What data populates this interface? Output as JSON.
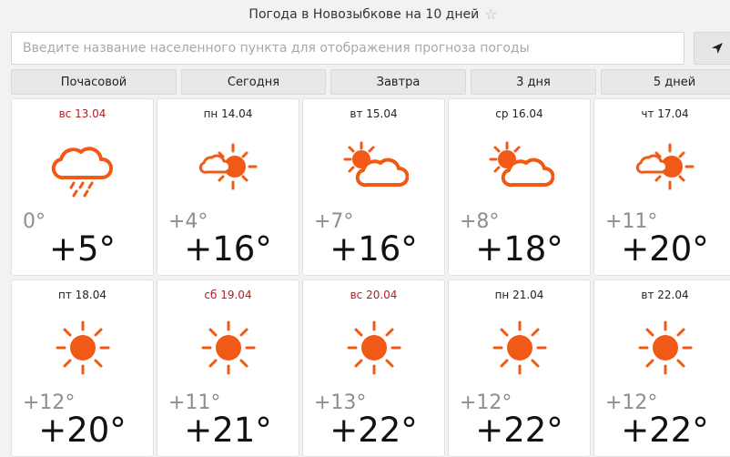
{
  "title": "Погода в Новозыбкове на 10 дней",
  "search": {
    "placeholder": "Введите название населенного пункта для отображения прогноза погоды",
    "value": ""
  },
  "tabs": [
    "Почасовой",
    "Сегодня",
    "Завтра",
    "3 дня",
    "5 дней"
  ],
  "colors": {
    "sun": "#f05a16",
    "weekend": "#b71c1c",
    "min_temp": "#8e8e8e"
  },
  "days": [
    {
      "date": "вс 13.04",
      "weekend": true,
      "icon": "cloud-rain-icon",
      "min": "0°",
      "max": "+5°"
    },
    {
      "date": "пн 14.04",
      "weekend": false,
      "icon": "sun-small-cloud-icon",
      "min": "+4°",
      "max": "+16°"
    },
    {
      "date": "вт 15.04",
      "weekend": false,
      "icon": "sun-behind-clouds-icon",
      "min": "+7°",
      "max": "+16°"
    },
    {
      "date": "ср 16.04",
      "weekend": false,
      "icon": "sun-behind-clouds-icon",
      "min": "+8°",
      "max": "+18°"
    },
    {
      "date": "чт 17.04",
      "weekend": false,
      "icon": "sun-small-cloud-icon",
      "min": "+11°",
      "max": "+20°"
    },
    {
      "date": "пт 18.04",
      "weekend": false,
      "icon": "sun-icon",
      "min": "+12°",
      "max": "+20°"
    },
    {
      "date": "сб 19.04",
      "weekend": true,
      "icon": "sun-icon",
      "min": "+11°",
      "max": "+21°"
    },
    {
      "date": "вс 20.04",
      "weekend": true,
      "icon": "sun-icon",
      "min": "+13°",
      "max": "+22°"
    },
    {
      "date": "пн 21.04",
      "weekend": false,
      "icon": "sun-icon",
      "min": "+12°",
      "max": "+22°"
    },
    {
      "date": "вт 22.04",
      "weekend": false,
      "icon": "sun-icon",
      "min": "+12°",
      "max": "+22°"
    }
  ]
}
